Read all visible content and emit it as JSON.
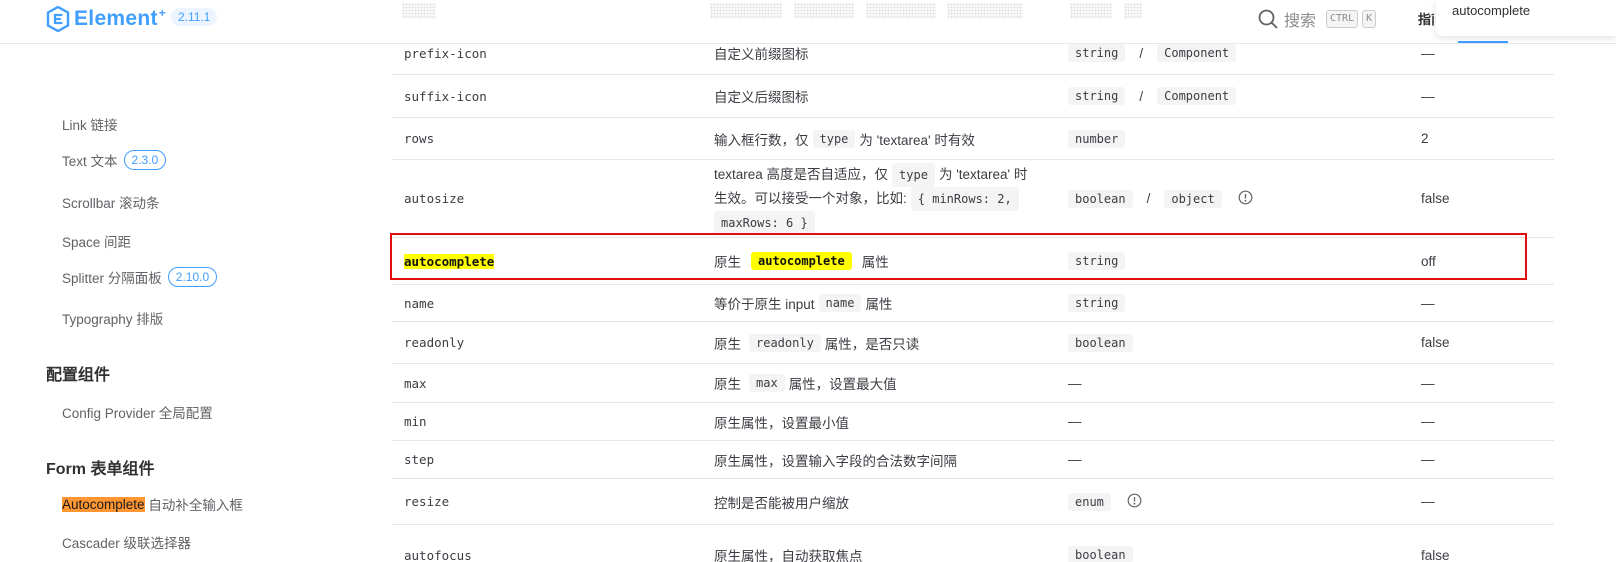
{
  "header": {
    "logo_text": "Element",
    "logo_plus": "+",
    "version": "2.11.1",
    "search_label": "搜索",
    "search_keys": [
      "CTRL",
      "K"
    ],
    "nav_guide": "指南",
    "popup_text": "autocomplete"
  },
  "sidebar": {
    "items": [
      {
        "label": "Link 链接"
      },
      {
        "label": "Text 文本",
        "badge": "2.3.0"
      },
      {
        "label": "Scrollbar 滚动条"
      },
      {
        "label": "Space 间距"
      },
      {
        "label": "Splitter 分隔面板",
        "badge": "2.10.0"
      },
      {
        "label": "Typography 排版"
      }
    ],
    "group_config": "配置组件",
    "config_item": "Config Provider 全局配置",
    "group_form": "Form 表单组件",
    "form_item_highlight": "Autocomplete",
    "form_item_rest": " 自动补全输入框",
    "form_item_next": "Cascader 级联选择器"
  },
  "table": {
    "rows": [
      {
        "name": "prefix-icon",
        "desc": "自定义前缀图标",
        "type_a": "string",
        "type_sep": "/",
        "type_b": "Component",
        "default": "—"
      },
      {
        "name": "suffix-icon",
        "desc": "自定义后缀图标",
        "type_a": "string",
        "type_sep": "/",
        "type_b": "Component",
        "default": "—"
      },
      {
        "name": "rows",
        "desc_pre": "输入框行数，仅",
        "desc_code": "type",
        "desc_post": "为 'textarea' 时有效",
        "type_a": "number",
        "default": "2"
      },
      {
        "name": "autosize",
        "desc_line1_pre": "textarea 高度是否自适应，仅",
        "desc_line1_code": "type",
        "desc_line1_post": "为 'textarea' 时",
        "desc_line2_pre": "生效。可以接受一个对象，比如:",
        "desc_line2_code": "{ minRows: 2,",
        "desc_line3_code": "maxRows: 6 }",
        "type_a": "boolean",
        "type_sep": "/",
        "type_b": "object",
        "default": "false"
      },
      {
        "name": "autocomplete",
        "desc_pre": "原生",
        "desc_code": "autocomplete",
        "desc_post": "属性",
        "type_a": "string",
        "default": "off"
      },
      {
        "name": "name",
        "desc_pre": "等价于原生 input",
        "desc_code": "name",
        "desc_post": "属性",
        "type_a": "string",
        "default": "—"
      },
      {
        "name": "readonly",
        "desc_pre": "原生",
        "desc_code": "readonly",
        "desc_post": "属性，是否只读",
        "type_a": "boolean",
        "default": "false"
      },
      {
        "name": "max",
        "desc_pre": "原生",
        "desc_code": "max",
        "desc_post": "属性，设置最大值",
        "type_plain": "—",
        "default": "—"
      },
      {
        "name": "min",
        "desc": "原生属性，设置最小值",
        "type_plain": "—",
        "default": "—"
      },
      {
        "name": "step",
        "desc": "原生属性，设置输入字段的合法数字间隔",
        "type_plain": "—",
        "default": "—"
      },
      {
        "name": "resize",
        "desc": "控制是否能被用户缩放",
        "type_a": "enum",
        "default": "—"
      },
      {
        "name": "autofocus",
        "desc": "原生属性，自动获取焦点",
        "type_a": "boolean",
        "default": "false"
      }
    ]
  },
  "colors": {
    "accent": "#409eff",
    "highlight_yellow": "#ffff00",
    "highlight_orange": "#ff9632",
    "annotation_red": "#e01010"
  }
}
